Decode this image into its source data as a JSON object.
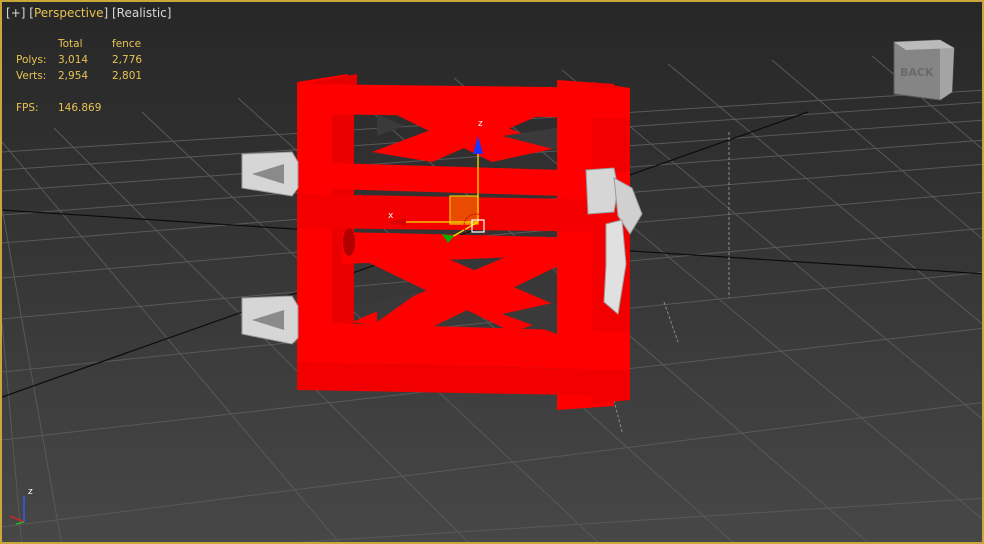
{
  "viewport": {
    "label_plus": "+",
    "label_view": "Perspective",
    "label_shading": "Realistic"
  },
  "stats": {
    "header_total": "Total",
    "header_selected": "fence",
    "polys_label": "Polys:",
    "polys_total": "3,014",
    "polys_selected": "2,776",
    "verts_label": "Verts:",
    "verts_total": "2,954",
    "verts_selected": "2,801",
    "fps_label": "FPS:",
    "fps_value": "146.869"
  },
  "viewcube": {
    "face_label": "BACK"
  },
  "gizmo": {
    "x_label": "x",
    "z_label": "z"
  },
  "axis_tripod": {
    "z_label": "z"
  },
  "colors": {
    "frame_border": "#c9a73a",
    "object_red": "#ff0000",
    "hinge_gray": "#d4d4d4",
    "grid_line": "#5a5a5a",
    "label_yellow": "#e8c352"
  }
}
